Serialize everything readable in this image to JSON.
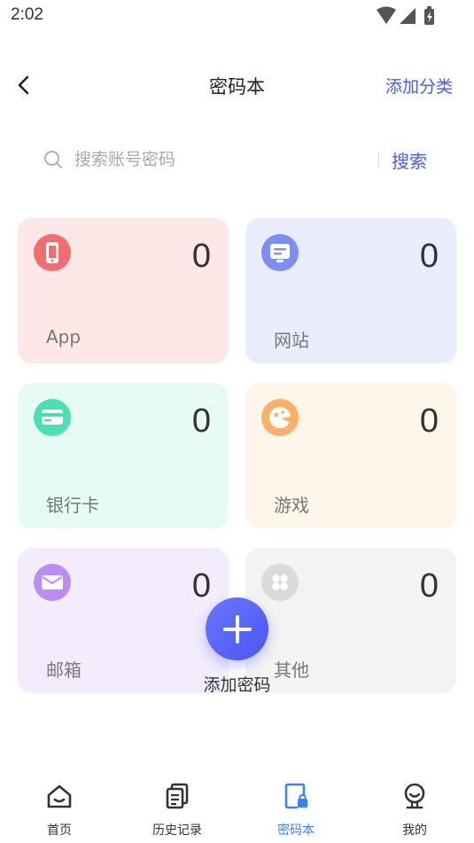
{
  "status_bar": {
    "time": "2:02"
  },
  "header": {
    "title": "密码本",
    "add_category_label": "添加分类"
  },
  "search": {
    "placeholder": "搜索账号密码",
    "value": "",
    "button_label": "搜索"
  },
  "categories": [
    {
      "label": "App",
      "count": "0",
      "icon": "phone-icon",
      "card_color": "#fde7e7",
      "icon_color": "#f26d6d"
    },
    {
      "label": "网站",
      "count": "0",
      "icon": "website-icon",
      "card_color": "#e9edfe",
      "icon_color": "#7c8ef6"
    },
    {
      "label": "银行卡",
      "count": "0",
      "icon": "bank-card-icon",
      "card_color": "#e6fbf4",
      "icon_color": "#49e0b4"
    },
    {
      "label": "游戏",
      "count": "0",
      "icon": "game-icon",
      "card_color": "#fef5eb",
      "icon_color": "#fbb068"
    },
    {
      "label": "邮箱",
      "count": "0",
      "icon": "mail-icon",
      "card_color": "#f2ecfd",
      "icon_color": "#b98cf6"
    },
    {
      "label": "其他",
      "count": "0",
      "icon": "other-icon",
      "card_color": "#f3f3f3",
      "icon_color": "#dadada"
    }
  ],
  "fab": {
    "label": "添加密码",
    "icon": "plus-icon"
  },
  "tabs": [
    {
      "label": "首页",
      "icon": "home-icon",
      "active": false
    },
    {
      "label": "历史记录",
      "icon": "history-icon",
      "active": false
    },
    {
      "label": "密码本",
      "icon": "password-book-icon",
      "active": true
    },
    {
      "label": "我的",
      "icon": "profile-icon",
      "active": false
    }
  ],
  "colors": {
    "accent": "#4a5cf0",
    "tab_active": "#3b82f6"
  }
}
